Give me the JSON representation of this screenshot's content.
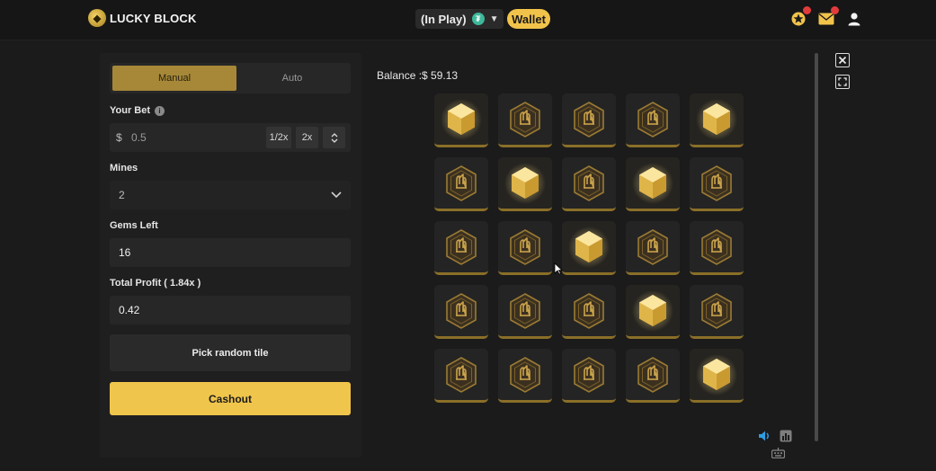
{
  "header": {
    "brand": "LUCKY BLOCK",
    "play_mode": "(In Play)",
    "currency_icon": "tether-icon",
    "wallet_label": "Wallet",
    "icons": [
      "star-badge-icon",
      "mail-icon",
      "user-icon"
    ]
  },
  "panel": {
    "tabs": [
      {
        "label": "Manual",
        "active": true
      },
      {
        "label": "Auto",
        "active": false
      }
    ],
    "bet": {
      "label": "Your Bet",
      "currency_symbol": "$",
      "value": "0.5",
      "half_label": "1/2x",
      "double_label": "2x"
    },
    "mines": {
      "label": "Mines",
      "value": "2"
    },
    "gems_left": {
      "label": "Gems Left",
      "value": "16"
    },
    "total_profit": {
      "label": "Total Profit ( 1.84x )",
      "value": "0.42"
    },
    "pick_random_label": "Pick random tile",
    "cashout_label": "Cashout"
  },
  "game": {
    "balance": "Balance :$ 59.13",
    "grid_rows": 5,
    "grid_cols": 5,
    "tiles": [
      "gem",
      "unrevealed",
      "unrevealed",
      "unrevealed",
      "gem",
      "unrevealed",
      "gem",
      "unrevealed",
      "gem",
      "unrevealed",
      "unrevealed",
      "unrevealed",
      "gem",
      "unrevealed",
      "unrevealed",
      "unrevealed",
      "unrevealed",
      "unrevealed",
      "gem",
      "unrevealed",
      "unrevealed",
      "unrevealed",
      "unrevealed",
      "unrevealed",
      "gem"
    ]
  },
  "colors": {
    "accent": "#f0c54c",
    "tab_active": "#a68838",
    "notification": "#e23b3b"
  }
}
